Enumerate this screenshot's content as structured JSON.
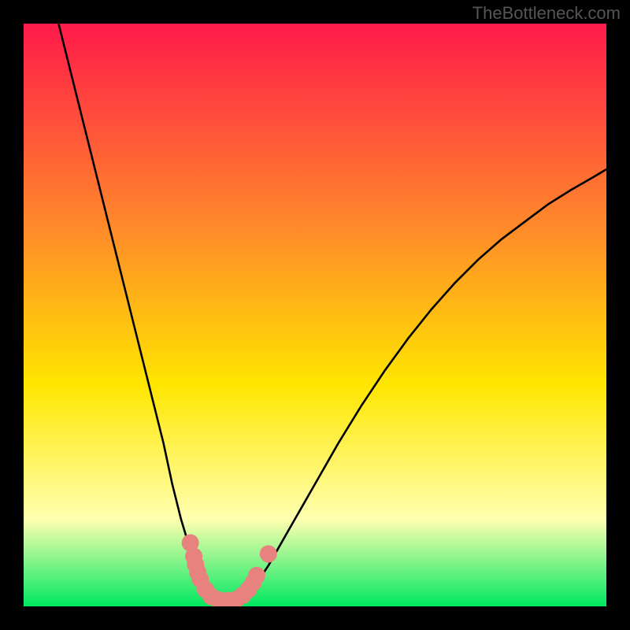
{
  "watermark": "TheBottleneck.com",
  "colors": {
    "gradient_top": "#ff1a4a",
    "gradient_mid_orange": "#ff8a2a",
    "gradient_yellow": "#ffe600",
    "gradient_pale": "#ffffb0",
    "gradient_green": "#00e860",
    "curve": "#000000",
    "markers": "#e8827e",
    "frame": "#000000"
  },
  "chart_data": {
    "type": "line",
    "title": "",
    "xlabel": "",
    "ylabel": "",
    "xlim": [
      0,
      100
    ],
    "ylim": [
      0,
      100
    ],
    "series": [
      {
        "name": "curve",
        "x": [
          6,
          8,
          10,
          12,
          14,
          16,
          18,
          20,
          22,
          24,
          25.5,
          27,
          28.5,
          30,
          31,
          32,
          33,
          34,
          35.5,
          37,
          38.5,
          40,
          42,
          44,
          46,
          50,
          54,
          58,
          62,
          66,
          70,
          74,
          78,
          82,
          86,
          90,
          94,
          98,
          100
        ],
        "y": [
          100,
          92,
          84,
          76,
          68,
          60,
          52,
          44,
          36,
          28,
          21,
          15,
          10,
          6,
          4,
          2.5,
          1.5,
          1,
          1,
          1.5,
          2.5,
          4,
          7,
          10.5,
          14,
          21,
          28,
          34.5,
          40.5,
          46,
          51,
          55.5,
          59.5,
          63,
          66,
          69,
          71.5,
          73.8,
          75
        ]
      }
    ],
    "markers": [
      {
        "x": 28.6,
        "y": 10.9
      },
      {
        "x": 29.2,
        "y": 8.6
      },
      {
        "x": 29.5,
        "y": 7.2
      },
      {
        "x": 29.9,
        "y": 5.8
      },
      {
        "x": 30.3,
        "y": 4.7
      },
      {
        "x": 31.2,
        "y": 2.9
      },
      {
        "x": 32.2,
        "y": 1.7
      },
      {
        "x": 33.5,
        "y": 1.1
      },
      {
        "x": 35.0,
        "y": 1.0
      },
      {
        "x": 36.5,
        "y": 1.2
      },
      {
        "x": 37.6,
        "y": 1.9
      },
      {
        "x": 38.6,
        "y": 2.9
      },
      {
        "x": 39.4,
        "y": 4.1
      },
      {
        "x": 40.0,
        "y": 5.3
      },
      {
        "x": 42.0,
        "y": 9.0
      }
    ],
    "marker_radius_px": 11
  }
}
